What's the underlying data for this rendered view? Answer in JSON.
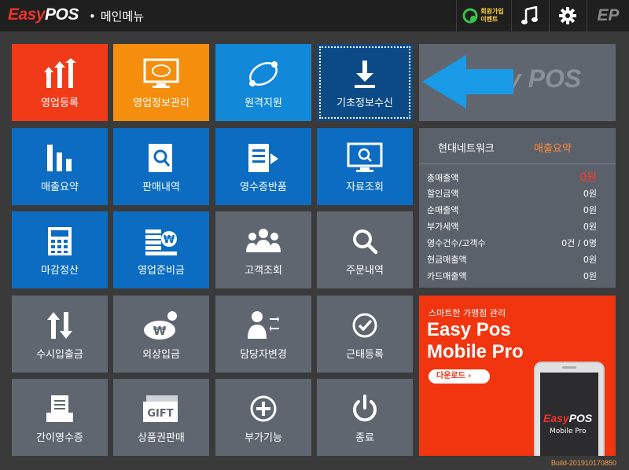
{
  "header": {
    "logo_easy": "Easy",
    "logo_pos": "POS",
    "title_dot": "•",
    "title": "메인메뉴",
    "event_line1": "회원가입",
    "event_line2": "이벤트",
    "ep_logo": "EP"
  },
  "tiles": [
    {
      "label": "영업등록",
      "icon": "chart-up-arrows-icon",
      "color": "#f03a18"
    },
    {
      "label": "영업정보관리",
      "icon": "monitor-icon",
      "color": "#f48e0c"
    },
    {
      "label": "원격지원",
      "icon": "remote-orbit-icon",
      "color": "#1288d8"
    },
    {
      "label": "기초정보수신",
      "icon": "download-icon",
      "color": "#0b4a86"
    },
    {
      "label": "매출요약",
      "icon": "bar-chart-icon",
      "color": "#0b6cc2"
    },
    {
      "label": "판매내역",
      "icon": "document-search-icon",
      "color": "#0b6cc2"
    },
    {
      "label": "영수증반품",
      "icon": "receipt-return-icon",
      "color": "#0b6cc2"
    },
    {
      "label": "자료조회",
      "icon": "monitor-search-icon",
      "color": "#0b6cc2"
    },
    {
      "label": "마감정산",
      "icon": "calculator-icon",
      "color": "#0b6cc2"
    },
    {
      "label": "영업준비금",
      "icon": "coins-won-icon",
      "color": "#0b6cc2"
    },
    {
      "label": "고객조회",
      "icon": "people-icon",
      "color": "#5f6670"
    },
    {
      "label": "주문내역",
      "icon": "magnifier-icon",
      "color": "#5f6670"
    },
    {
      "label": "수시입출금",
      "icon": "up-down-arrows-icon",
      "color": "#5f6670"
    },
    {
      "label": "외상입금",
      "icon": "money-bag-won-icon",
      "color": "#5f6670"
    },
    {
      "label": "담당자변경",
      "icon": "user-swap-icon",
      "color": "#5f6670"
    },
    {
      "label": "근태등록",
      "icon": "check-circle-icon",
      "color": "#5f6670"
    },
    {
      "label": "간이영수증",
      "icon": "receipt-printer-icon",
      "color": "#5f6670"
    },
    {
      "label": "상품권판매",
      "icon": "gift-card-icon",
      "color": "#5f6670"
    },
    {
      "label": "부가기능",
      "icon": "plus-circle-icon",
      "color": "#5f6670"
    },
    {
      "label": "종료",
      "icon": "power-icon",
      "color": "#5f6670"
    }
  ],
  "brand_panel": {
    "watermark": "Easy POS"
  },
  "summary": {
    "tab_store": "현대네트워크",
    "tab_sales": "매출요약",
    "rows": [
      {
        "label": "총매출액",
        "value": "0원"
      },
      {
        "label": "할인금액",
        "value": "0원"
      },
      {
        "label": "순매출액",
        "value": "0원"
      },
      {
        "label": "부가세액",
        "value": "0원"
      },
      {
        "label": "영수건수/고객수",
        "value": "0건 / 0명"
      },
      {
        "label": "현금매출액",
        "value": "0원"
      },
      {
        "label": "카드매출액",
        "value": "0원"
      }
    ]
  },
  "ad": {
    "subtitle": "스마트한 가맹점 관리",
    "title1": "Easy Pos",
    "title2": "Mobile Pro",
    "download": "다운로드",
    "phone_easy": "Easy",
    "phone_pos": "POS",
    "phone_sub": "Mobile Pro"
  },
  "build": "Build-201910170850",
  "colors": {
    "accent_red": "#f03a18",
    "accent_orange": "#ff8a3a",
    "highlight_value": "#ff3b2b"
  }
}
